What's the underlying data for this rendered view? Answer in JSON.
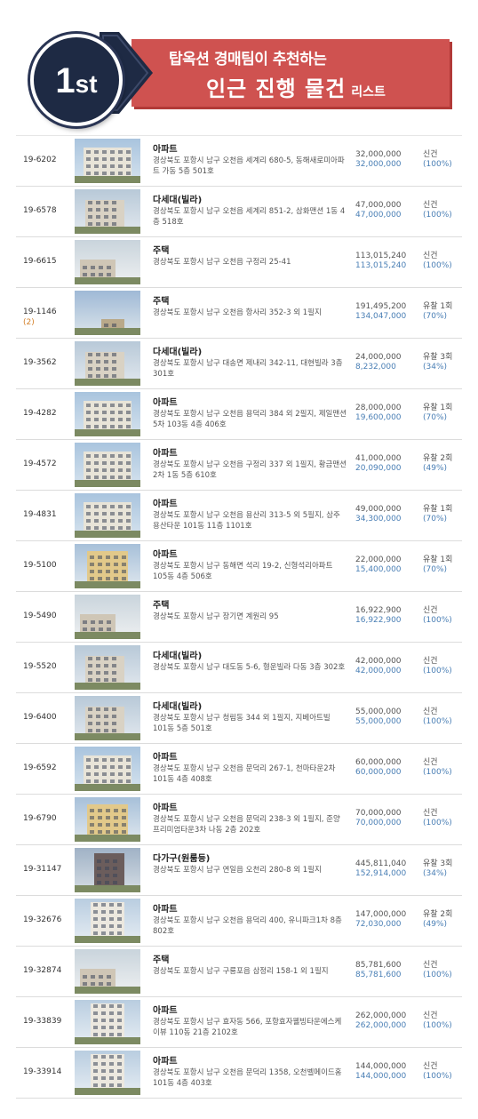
{
  "banner": {
    "rank_number": "1",
    "rank_suffix": "st",
    "line1": "탑옥션 경매팀이 추천하는",
    "line2_big": "인근 진행 물건",
    "line2_small": "리스트",
    "colors": {
      "badge": "#1e2a44",
      "banner": "#cf5250",
      "arrow": "#1e2a44"
    }
  },
  "listings": [
    {
      "case_no": "19-6202",
      "case_sub": "",
      "type": "아파트",
      "address": "경상북도 포항시 남구 오천읍 세계리 680-5, 동해새로미아파트 가동 5층 501호",
      "appraisal": "32,000,000",
      "min_price": "32,000,000",
      "status": "신건",
      "rate": "(100%)",
      "photo": "apartment"
    },
    {
      "case_no": "19-6578",
      "case_sub": "",
      "type": "다세대(빌라)",
      "address": "경상북도 포항시 남구 오천읍 세계리 851-2, 삼화맨션 1동 4층 518호",
      "appraisal": "47,000,000",
      "min_price": "47,000,000",
      "status": "신건",
      "rate": "(100%)",
      "photo": "villa"
    },
    {
      "case_no": "19-6615",
      "case_sub": "",
      "type": "주택",
      "address": "경상북도 포항시 남구 오천읍 구정리 25-41",
      "appraisal": "113,015,240",
      "min_price": "113,015,240",
      "status": "신건",
      "rate": "(100%)",
      "photo": "house"
    },
    {
      "case_no": "19-1146",
      "case_sub": "(2)",
      "type": "주택",
      "address": "경상북도 포항시 남구 오천읍 항사리 352-3 외 1필지",
      "appraisal": "191,495,200",
      "min_price": "134,047,000",
      "status": "유찰 1회",
      "rate": "(70%)",
      "photo": "rural"
    },
    {
      "case_no": "19-3562",
      "case_sub": "",
      "type": "다세대(빌라)",
      "address": "경상북도 포항시 남구 대송면 제내리 342-11, 대현빌라 3층 301호",
      "appraisal": "24,000,000",
      "min_price": "8,232,000",
      "status": "유찰 3회",
      "rate": "(34%)",
      "photo": "villa"
    },
    {
      "case_no": "19-4282",
      "case_sub": "",
      "type": "아파트",
      "address": "경상북도 포항시 남구 오천읍 용덕리 384 외 2필지, 제일맨션5차 103동 4층 406호",
      "appraisal": "28,000,000",
      "min_price": "19,600,000",
      "status": "유찰 1회",
      "rate": "(70%)",
      "photo": "apartment"
    },
    {
      "case_no": "19-4572",
      "case_sub": "",
      "type": "아파트",
      "address": "경상북도 포항시 남구 오천읍 구정리 337 외 1필지, 황금맨션2차 1동 5층 610호",
      "appraisal": "41,000,000",
      "min_price": "20,090,000",
      "status": "유찰 2회",
      "rate": "(49%)",
      "photo": "apartment"
    },
    {
      "case_no": "19-4831",
      "case_sub": "",
      "type": "아파트",
      "address": "경상북도 포항시 남구 오천읍 용산리 313-5 외 5필지, 삼주용산타운 101동 11층 1101호",
      "appraisal": "49,000,000",
      "min_price": "34,300,000",
      "status": "유찰 1회",
      "rate": "(70%)",
      "photo": "apartment"
    },
    {
      "case_no": "19-5100",
      "case_sub": "",
      "type": "아파트",
      "address": "경상북도 포항시 남구 동해면 석리 19-2, 신형석리아파트 105동 4층 506호",
      "appraisal": "22,000,000",
      "min_price": "15,400,000",
      "status": "유찰 1회",
      "rate": "(70%)",
      "photo": "colorful"
    },
    {
      "case_no": "19-5490",
      "case_sub": "",
      "type": "주택",
      "address": "경상북도 포항시 남구 장기면 계원리 95",
      "appraisal": "16,922,900",
      "min_price": "16,922,900",
      "status": "신건",
      "rate": "(100%)",
      "photo": "house"
    },
    {
      "case_no": "19-5520",
      "case_sub": "",
      "type": "다세대(빌라)",
      "address": "경상북도 포항시 남구 대도동 5-6, 형운빌라 다동 3층 302호",
      "appraisal": "42,000,000",
      "min_price": "42,000,000",
      "status": "신건",
      "rate": "(100%)",
      "photo": "villa"
    },
    {
      "case_no": "19-6400",
      "case_sub": "",
      "type": "다세대(빌라)",
      "address": "경상북도 포항시 남구 청림동 344 외 1필지, 지베아트빌 101동 5층 501호",
      "appraisal": "55,000,000",
      "min_price": "55,000,000",
      "status": "신건",
      "rate": "(100%)",
      "photo": "villa"
    },
    {
      "case_no": "19-6592",
      "case_sub": "",
      "type": "아파트",
      "address": "경상북도 포항시 남구 오천읍 문덕리 267-1, 천마타운2차 101동 4층 408호",
      "appraisal": "60,000,000",
      "min_price": "60,000,000",
      "status": "신건",
      "rate": "(100%)",
      "photo": "apartment"
    },
    {
      "case_no": "19-6790",
      "case_sub": "",
      "type": "아파트",
      "address": "경상북도 포항시 남구 오천읍 문덕리 238-3 외 1필지, 준양프리미엄타운3차 나동 2층 202호",
      "appraisal": "70,000,000",
      "min_price": "70,000,000",
      "status": "신건",
      "rate": "(100%)",
      "photo": "colorful"
    },
    {
      "case_no": "19-31147",
      "case_sub": "",
      "type": "다가구(원룸등)",
      "address": "경상북도 포항시 남구 연일읍 오천리 280-8 외 1필지",
      "appraisal": "445,811,040",
      "min_price": "152,914,000",
      "status": "유찰 3회",
      "rate": "(34%)",
      "photo": "dark"
    },
    {
      "case_no": "19-32676",
      "case_sub": "",
      "type": "아파트",
      "address": "경상북도 포항시 남구 오천읍 용덕리 400, 유니파크1차 8층 802호",
      "appraisal": "147,000,000",
      "min_price": "72,030,000",
      "status": "유찰 2회",
      "rate": "(49%)",
      "photo": "tower"
    },
    {
      "case_no": "19-32874",
      "case_sub": "",
      "type": "주택",
      "address": "경상북도 포항시 남구 구룡포읍 삼정리 158-1 외 1필지",
      "appraisal": "85,781,600",
      "min_price": "85,781,600",
      "status": "신건",
      "rate": "(100%)",
      "photo": "house"
    },
    {
      "case_no": "19-33839",
      "case_sub": "",
      "type": "아파트",
      "address": "경상북도 포항시 남구 효자동 566, 포항효자웰빙타운에스케이뷰 110동 21층 2102호",
      "appraisal": "262,000,000",
      "min_price": "262,000,000",
      "status": "신건",
      "rate": "(100%)",
      "photo": "tower"
    },
    {
      "case_no": "19-33914",
      "case_sub": "",
      "type": "아파트",
      "address": "경상북도 포항시 남구 오천읍 문덕리 1358, 오천벨메이드홈 101동 4층 403호",
      "appraisal": "144,000,000",
      "min_price": "144,000,000",
      "status": "신건",
      "rate": "(100%)",
      "photo": "tower"
    }
  ]
}
